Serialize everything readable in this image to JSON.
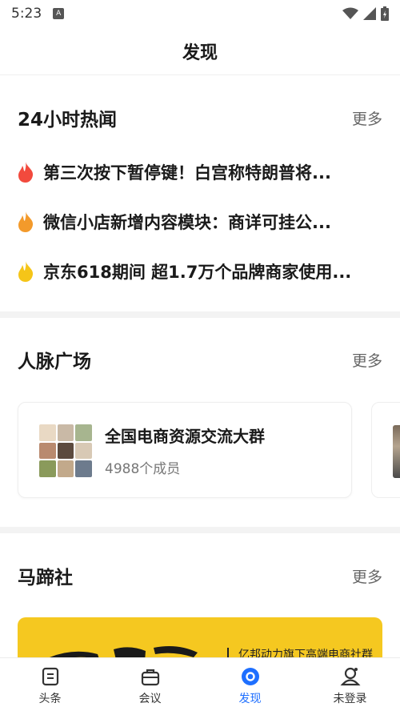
{
  "status_bar": {
    "time": "5:23",
    "app_icon": "A"
  },
  "header": {
    "title": "发现"
  },
  "hot_news": {
    "title": "24小时热闻",
    "more": "更多",
    "items": [
      {
        "text": "第三次按下暂停键！白宫称特朗普将...",
        "flame_color": "#f24a3d"
      },
      {
        "text": "微信小店新增内容模块：商详可挂公...",
        "flame_color": "#f39a2b"
      },
      {
        "text": "京东618期间 超1.7万个品牌商家使用...",
        "flame_color": "#f5c518"
      }
    ]
  },
  "network": {
    "title": "人脉广场",
    "more": "更多",
    "card": {
      "name": "全国电商资源交流大群",
      "members": "4988个成员"
    }
  },
  "mati": {
    "title": "马蹄社",
    "more": "更多",
    "banner_text": "亿邦动力旗下高端电商社群",
    "banner_color": "#f5c820"
  },
  "tabs": [
    {
      "label": "头条",
      "icon": "news-icon",
      "active": false
    },
    {
      "label": "会议",
      "icon": "briefcase-icon",
      "active": false
    },
    {
      "label": "发现",
      "icon": "discover-icon",
      "active": true
    },
    {
      "label": "未登录",
      "icon": "user-icon",
      "active": false
    }
  ],
  "colors": {
    "accent": "#1e6fff",
    "text": "#1a1a1a",
    "muted": "#666666"
  }
}
